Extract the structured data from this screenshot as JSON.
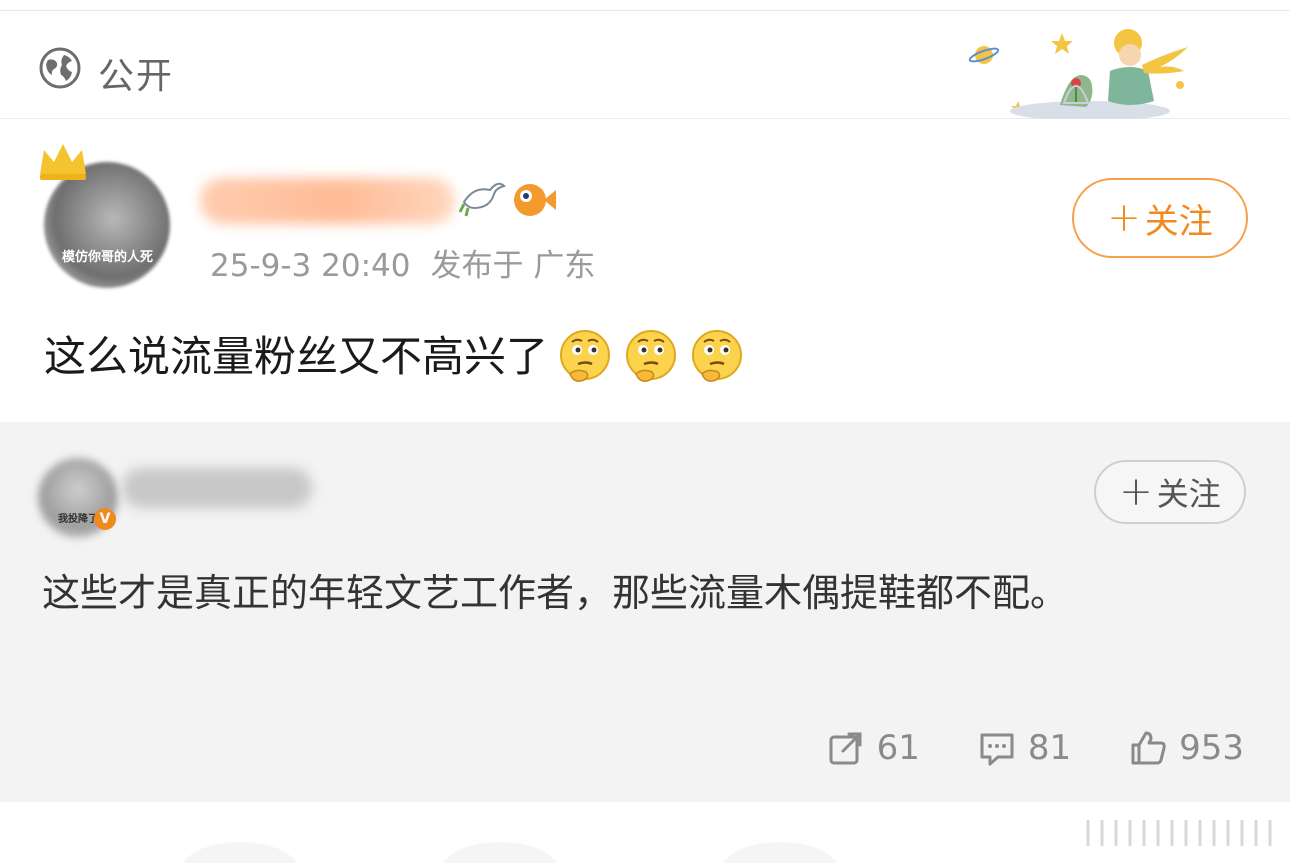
{
  "visibility": {
    "label": "公开",
    "icon": "globe-icon"
  },
  "post": {
    "avatar_caption": "模仿你哥的人死",
    "timestamp": "25-9-3 20:40",
    "location": "发布于 广东",
    "follow_label": "关注",
    "text": "这么说流量粉丝又不高兴了",
    "emoji": [
      "thinking-face-icon",
      "thinking-face-icon",
      "thinking-face-icon"
    ]
  },
  "repost": {
    "avatar_tag": "我投降了",
    "verified_badge": "V",
    "follow_label": "关注",
    "text": "这些才是真正的年轻文艺工作者，那些流量木偶提鞋都不配。",
    "actions": {
      "share_count": "61",
      "comment_count": "81",
      "like_count": "953"
    }
  },
  "colors": {
    "accent": "#f08a1e",
    "background_repost": "#f3f3f3",
    "meta_text": "#9a9a9a"
  }
}
